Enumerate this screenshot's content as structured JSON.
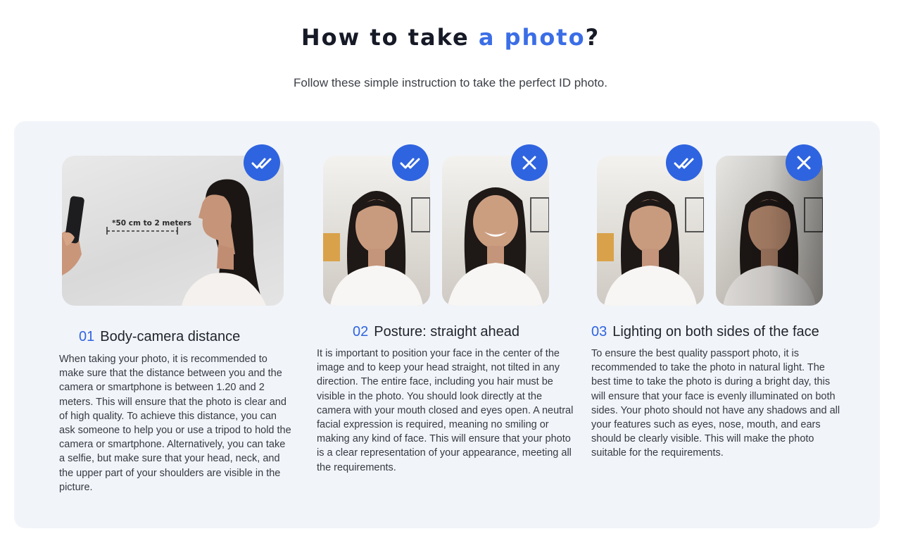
{
  "header": {
    "title_prefix": "How to take ",
    "title_accent": "a photo",
    "title_suffix": "?",
    "subtitle": "Follow these simple instruction to take the perfect ID photo."
  },
  "colors": {
    "accent": "#2f64e0",
    "panel": "#f1f4f9"
  },
  "steps": [
    {
      "number": "01",
      "title": "Body-camera distance",
      "distance_label": "*50 cm to 2 meters",
      "badges": [
        "double-check-icon"
      ],
      "text": "When taking your photo, it is recommended to make sure that the distance between you and the camera or smartphone is between 1.20 and 2 meters. This will ensure that the photo is clear and of high quality. To achieve this distance, you can ask someone to help you or use a tripod to hold the camera or smartphone. Alternatively, you can take a selfie, but make sure that your head, neck, and the upper part of your shoulders are visible in the picture."
    },
    {
      "number": "02",
      "title": "Posture: straight ahead",
      "badges": [
        "double-check-icon",
        "close-icon"
      ],
      "text": "It is important to position your face in the center of the image and to keep your head straight, not tilted in any direction. The entire face, including you hair must be visible in the photo. You should look directly at the camera with your mouth closed and eyes open. A neutral facial expression is required, meaning no smiling or making any kind of face. This will ensure that your photo is a clear representation of your appearance, meeting all the requirements."
    },
    {
      "number": "03",
      "title": "Lighting on both sides of the face",
      "badges": [
        "double-check-icon",
        "close-icon"
      ],
      "text": "To ensure the best quality passport photo, it is recommended to take the photo in natural light. The best time to take the photo is during a bright day, this will ensure that your face is evenly illuminated on both sides. Your photo should not have any shadows and all your features such as eyes, nose, mouth, and ears should be clearly visible. This will make the photo suitable for the requirements."
    }
  ]
}
